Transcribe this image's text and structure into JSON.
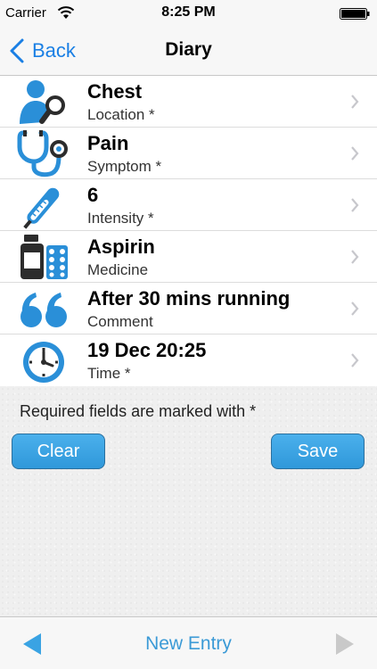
{
  "status_bar": {
    "carrier": "Carrier",
    "time": "8:25 PM"
  },
  "nav": {
    "back_label": "Back",
    "title": "Diary"
  },
  "rows": [
    {
      "title": "Chest",
      "subtitle": "Location *",
      "icon": "person-search-icon"
    },
    {
      "title": "Pain",
      "subtitle": "Symptom *",
      "icon": "stethoscope-icon"
    },
    {
      "title": "6",
      "subtitle": "Intensity *",
      "icon": "thermometer-icon"
    },
    {
      "title": "Aspirin",
      "subtitle": "Medicine",
      "icon": "pill-bottle-icon"
    },
    {
      "title": "After 30 mins running",
      "subtitle": "Comment",
      "icon": "quote-icon"
    },
    {
      "title": "19 Dec 20:25",
      "subtitle": "Time *",
      "icon": "clock-icon"
    }
  ],
  "note": "Required fields are marked with *",
  "buttons": {
    "clear": "Clear",
    "save": "Save"
  },
  "toolbar": {
    "title": "New Entry"
  },
  "colors": {
    "accent": "#1a7fe4",
    "button": "#3aa3e3",
    "icon_blue": "#2a8fd8",
    "icon_dark": "#2c2c2c"
  }
}
